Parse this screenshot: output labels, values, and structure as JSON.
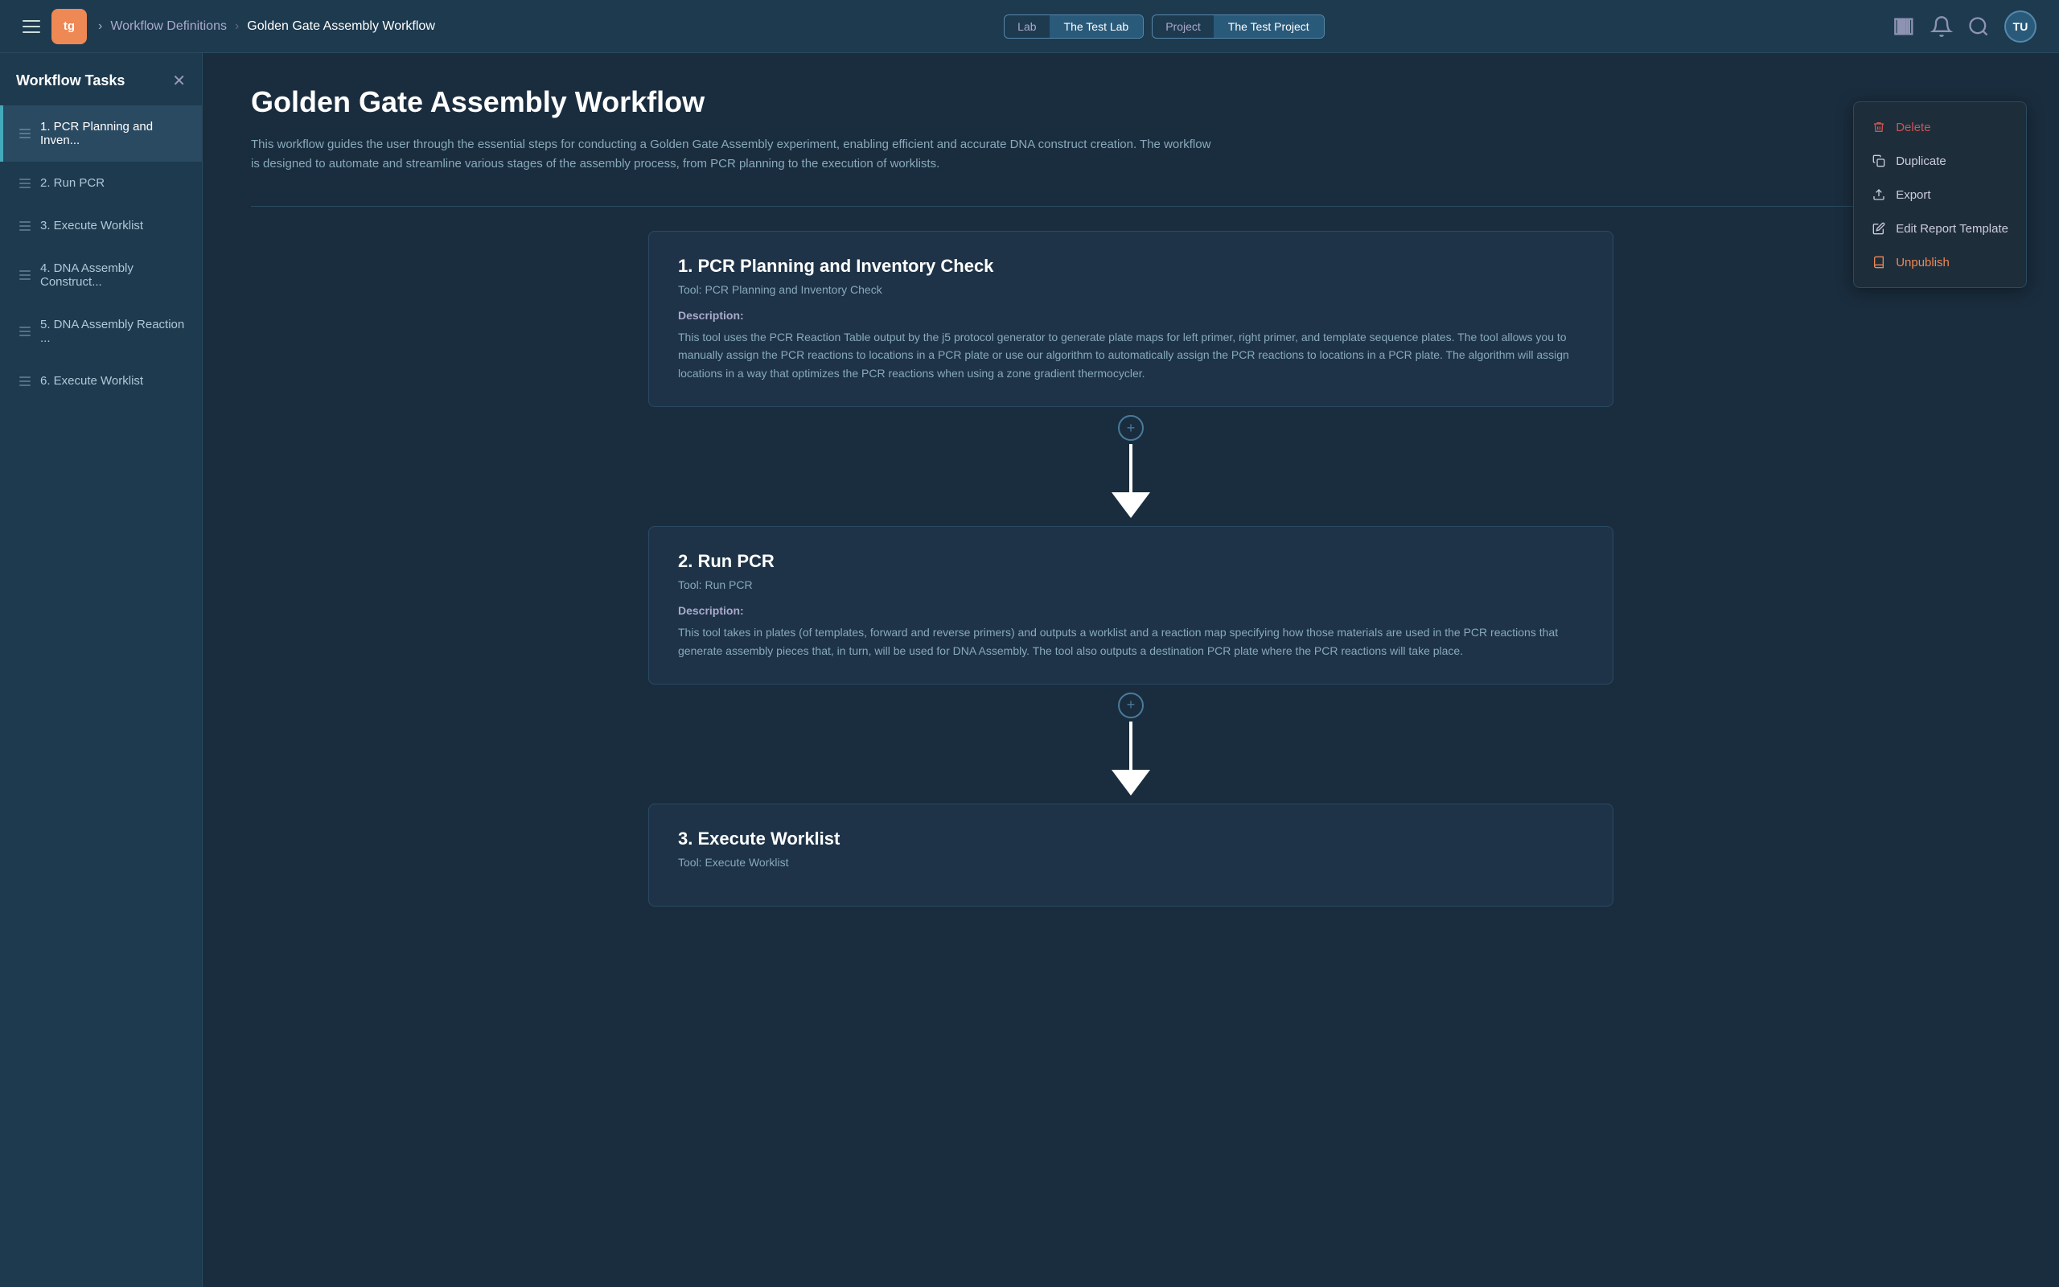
{
  "topNav": {
    "logo": "tg",
    "breadcrumbs": [
      {
        "label": "Workflow Definitions",
        "active": false
      },
      {
        "label": "Golden Gate Assembly Workflow",
        "active": true
      }
    ],
    "lab": {
      "label": "Lab",
      "value": "The Test Lab"
    },
    "project": {
      "label": "Project",
      "value": "The Test Project"
    },
    "avatar": "TU"
  },
  "sidebar": {
    "title": "Workflow Tasks",
    "items": [
      {
        "id": 1,
        "label": "1. PCR Planning and Inven...",
        "active": true
      },
      {
        "id": 2,
        "label": "2. Run PCR",
        "active": false
      },
      {
        "id": 3,
        "label": "3. Execute Worklist",
        "active": false
      },
      {
        "id": 4,
        "label": "4. DNA Assembly Construct...",
        "active": false
      },
      {
        "id": 5,
        "label": "5. DNA Assembly Reaction ...",
        "active": false
      },
      {
        "id": 6,
        "label": "6. Execute Worklist",
        "active": false
      }
    ]
  },
  "workflow": {
    "title": "Golden Gate Assembly Workflow",
    "description": "This workflow guides the user through the essential steps for conducting a Golden Gate Assembly experiment, enabling efficient and accurate DNA construct creation. The workflow is designed to automate and streamline various stages of the assembly process, from PCR planning to the execution of worklists."
  },
  "contextMenu": {
    "items": [
      {
        "id": "delete",
        "label": "Delete",
        "icon": "trash",
        "style": "delete"
      },
      {
        "id": "duplicate",
        "label": "Duplicate",
        "icon": "copy",
        "style": "normal"
      },
      {
        "id": "export",
        "label": "Export",
        "icon": "export",
        "style": "normal"
      },
      {
        "id": "editReport",
        "label": "Edit Report Template",
        "icon": "pencil",
        "style": "normal"
      },
      {
        "id": "unpublish",
        "label": "Unpublish",
        "icon": "book",
        "style": "unpublish"
      }
    ]
  },
  "tasks": [
    {
      "id": 1,
      "title": "1. PCR Planning and Inventory Check",
      "toolLabel": "Tool:",
      "toolName": "PCR Planning and Inventory Check",
      "descriptionLabel": "Description:",
      "description": "This tool uses the PCR Reaction Table output by the j5 protocol generator to generate plate maps for left primer, right primer, and template sequence plates. The tool allows you to manually assign the PCR reactions to locations in a PCR plate or use our algorithm to automatically assign the PCR reactions to locations in a PCR plate. The algorithm will assign locations in a way that optimizes the PCR reactions when using a zone gradient thermocycler."
    },
    {
      "id": 2,
      "title": "2. Run PCR",
      "toolLabel": "Tool:",
      "toolName": "Run PCR",
      "descriptionLabel": "Description:",
      "description": "This tool takes in plates (of templates, forward and reverse primers) and outputs a worklist and a reaction map specifying how those materials are used in the PCR reactions that generate assembly pieces that, in turn, will be used for DNA Assembly. The tool also outputs a destination PCR plate where the PCR reactions will take place."
    },
    {
      "id": 3,
      "title": "3. Execute Worklist",
      "toolLabel": "Tool:",
      "toolName": "Execute Worklist",
      "descriptionLabel": "Description:",
      "description": ""
    }
  ]
}
